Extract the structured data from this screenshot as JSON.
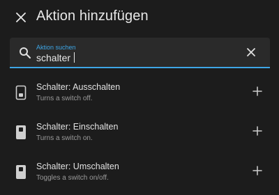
{
  "header": {
    "title": "Aktion hinzufügen",
    "close_icon": "close-icon"
  },
  "search": {
    "label": "Aktion suchen",
    "value": "schalter",
    "search_icon": "search-icon",
    "clear_icon": "clear-icon",
    "accent_color": "#3ea6e6"
  },
  "actions": [
    {
      "title": "Schalter: Ausschalten",
      "description": "Turns a switch off.",
      "icon": "switch-off-icon"
    },
    {
      "title": "Schalter: Einschalten",
      "description": "Turns a switch on.",
      "icon": "switch-on-icon"
    },
    {
      "title": "Schalter: Umschalten",
      "description": "Toggles a switch on/off.",
      "icon": "switch-toggle-icon"
    }
  ]
}
